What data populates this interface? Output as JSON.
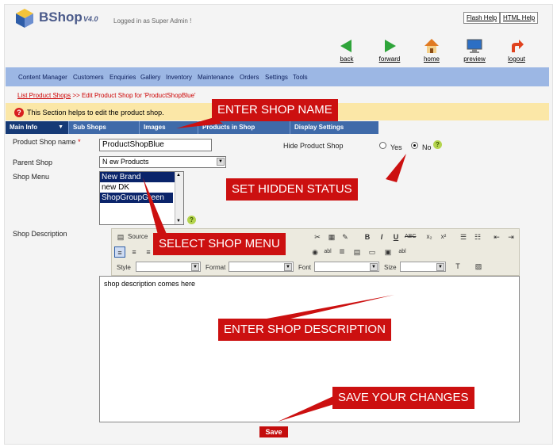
{
  "header": {
    "logo_text": "BShop",
    "version": "V4.0",
    "logged_in": "Logged in as Super Admin !",
    "flash_help": "Flash Help",
    "html_help": "HTML Help"
  },
  "nav_buttons": [
    {
      "label": "back",
      "icon": "back-arrow-icon",
      "color": "#2ea43a"
    },
    {
      "label": "forward",
      "icon": "forward-arrow-icon",
      "color": "#2ea43a"
    },
    {
      "label": "home",
      "icon": "home-icon",
      "color": "#e07a22"
    },
    {
      "label": "preview",
      "icon": "monitor-icon",
      "color": "#2d6fc4"
    },
    {
      "label": "logout",
      "icon": "logout-arrow-icon",
      "color": "#e0421e"
    }
  ],
  "menu": [
    "Content Manager",
    "Customers",
    "Enquiries",
    "Gallery",
    "Inventory",
    "Maintenance",
    "Orders",
    "Settings",
    "Tools"
  ],
  "breadcrumb": {
    "link": "List Product Shops",
    "rest": " >> Edit Product Shop for 'ProductShopBlue'"
  },
  "info": {
    "icon": "?",
    "text": "This Section helps to edit the product shop."
  },
  "tabs": [
    "Main Info",
    "Sub Shops",
    "Images",
    "Products in Shop",
    "Display Settings"
  ],
  "form": {
    "shop_name_label": "Product Shop name",
    "required_mark": "*",
    "shop_name_value": "ProductShopBlue",
    "hide_label": "Hide Product Shop",
    "yes_label": "Yes",
    "no_label": "No",
    "hide_selected": "No",
    "parent_label": "Parent Shop",
    "parent_value": "N ew Products",
    "menu_label": "Shop Menu",
    "menu_options": [
      "New Brand",
      "new DK",
      "ShopGroupGreen"
    ],
    "menu_selected": [
      "New Brand",
      "ShopGroupGreen"
    ],
    "help_icon": "?",
    "description_label": "Shop Description",
    "description_value": "shop description comes here",
    "save_label": "Save"
  },
  "editor": {
    "source_label": "Source",
    "style_label": "Style",
    "format_label": "Format",
    "font_label": "Font",
    "size_label": "Size"
  },
  "callouts": {
    "shop_name": "ENTER SHOP NAME",
    "hidden": "SET HIDDEN STATUS",
    "menu": "SELECT SHOP MENU",
    "description": "ENTER SHOP DESCRIPTION",
    "save": "SAVE YOUR CHANGES"
  },
  "colors": {
    "brand": "#4a5a8a",
    "menu_bar": "#9cb7e4",
    "tab_bar": "#3f6aa9",
    "info_bar": "#fbe7a7",
    "callout": "#cc1010",
    "save": "#c40d0d"
  }
}
